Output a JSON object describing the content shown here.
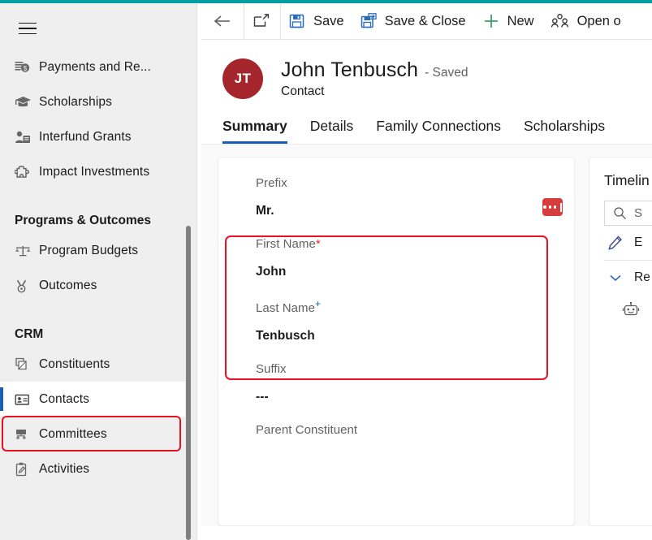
{
  "theme": {
    "accent_teal": "#00A0A0",
    "accent_blue": "#1a5fb4",
    "avatar_red": "#A4262C",
    "annotation_red": "#e81123",
    "badge_red": "#d73d3d",
    "required_red": "#d13438"
  },
  "sidebar": {
    "hamburger_label": "site-map-menu",
    "items": [
      {
        "label": "Payments and Re...",
        "icon": "payments-icon",
        "selected": false
      },
      {
        "label": "Scholarships",
        "icon": "graduation-cap-icon",
        "selected": false
      },
      {
        "label": "Interfund Grants",
        "icon": "people-card-icon",
        "selected": false
      },
      {
        "label": "Impact Investments",
        "icon": "puzzle-piece-icon",
        "selected": false
      }
    ],
    "groups": [
      {
        "title": "Programs & Outcomes",
        "items": [
          {
            "label": "Program Budgets",
            "icon": "scales-balance-icon",
            "selected": false
          },
          {
            "label": "Outcomes",
            "icon": "medal-icon",
            "selected": false
          }
        ]
      },
      {
        "title": "CRM",
        "items": [
          {
            "label": "Constituents",
            "icon": "documents-icon",
            "selected": false
          },
          {
            "label": "Contacts",
            "icon": "contact-card-icon",
            "selected": true
          },
          {
            "label": "Committees",
            "icon": "org-chart-icon",
            "selected": false
          },
          {
            "label": "Activities",
            "icon": "clipboard-pen-icon",
            "selected": false
          }
        ]
      }
    ]
  },
  "commandbar": {
    "back_icon": "back-arrow-icon",
    "popout_icon": "open-in-new-window-icon",
    "buttons": [
      {
        "label": "Save",
        "icon": "save-floppy-icon"
      },
      {
        "label": "Save & Close",
        "icon": "save-and-close-icon"
      },
      {
        "label": "New",
        "icon": "plus-icon"
      },
      {
        "label": "Open o",
        "icon": "people-icon"
      }
    ]
  },
  "record": {
    "avatar_initials": "JT",
    "name": "John Tenbusch",
    "status": "- Saved",
    "entity": "Contact"
  },
  "tabs": [
    {
      "label": "Summary",
      "active": true
    },
    {
      "label": "Details",
      "active": false
    },
    {
      "label": "Family Connections",
      "active": false
    },
    {
      "label": "Scholarships",
      "active": false
    }
  ],
  "form": {
    "fields": [
      {
        "label": "Prefix",
        "value": "Mr.",
        "marker": "",
        "badge": "ellipsis-badge"
      },
      {
        "label": "First Name",
        "value": "John",
        "marker": "*"
      },
      {
        "label": "Last Name",
        "value": "Tenbusch",
        "marker": "+"
      },
      {
        "label": "Suffix",
        "value": "---",
        "marker": ""
      },
      {
        "label": "Parent Constituent",
        "value": "",
        "marker": ""
      }
    ]
  },
  "timeline": {
    "title": "Timelin",
    "search_placeholder": "S",
    "note_label": "E",
    "recent_label": "Re",
    "bot_icon": "bot-icon"
  }
}
